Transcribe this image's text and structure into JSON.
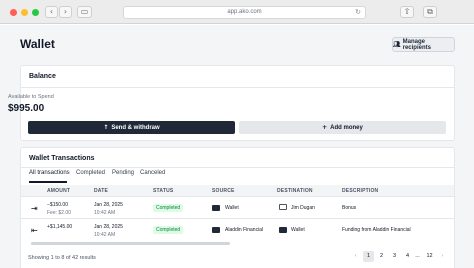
{
  "browser": {
    "url": "app.ako.com"
  },
  "colors": {
    "accent_dark": "#1f2937",
    "status_green_bg": "#dcfce7",
    "status_green_text": "#15803d"
  },
  "header": {
    "title": "Wallet",
    "manage_recipients_label": "Manage recipients"
  },
  "balance": {
    "title": "Balance",
    "available_label": "Available to Spend",
    "amount": "$995.00",
    "send_withdraw_label": "Send & withdraw",
    "add_money_label": "Add money"
  },
  "transactions": {
    "title": "Wallet Transactions",
    "tabs": [
      "All transactions",
      "Completed",
      "Pending",
      "Canceled"
    ],
    "active_tab": "All transactions",
    "columns": [
      "AMOUNT",
      "DATE",
      "STATUS",
      "SOURCE",
      "DESTINATION",
      "DESCRIPTION"
    ],
    "rows": [
      {
        "direction_icon": "arrow-right-to-bar-icon",
        "amount": "−$150.00",
        "fee": "Fee: $2.00",
        "date": "Jan 28, 2025",
        "time": "10:42 AM",
        "status": "Completed",
        "source": "Wallet",
        "destination": "Jim Dugan",
        "description": "Bonus"
      },
      {
        "direction_icon": "arrow-left-from-bar-icon",
        "amount": "+$1,145.00",
        "fee": "",
        "date": "Jan 28, 2025",
        "time": "10:42 AM",
        "status": "Completed",
        "source": "Aladdin Financial",
        "destination": "Wallet",
        "description": "Funding from Aladdin Financial"
      }
    ]
  },
  "footer": {
    "showing_text": "Showing 1 to 8 of 42 results",
    "pages": [
      "1",
      "2",
      "3",
      "4",
      "...",
      "12"
    ],
    "current_page": "1"
  }
}
